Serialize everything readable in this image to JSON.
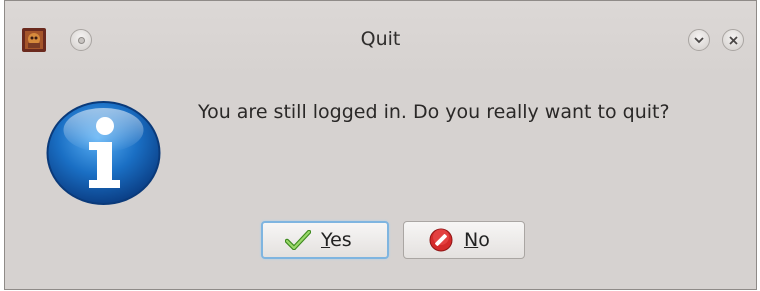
{
  "window": {
    "title": "Quit"
  },
  "titlebar": {
    "app_icon": "app-icon",
    "left_buttons": [
      "pin-icon"
    ],
    "right_buttons": [
      "minimize-icon",
      "close-icon"
    ]
  },
  "dialog": {
    "icon": "information-icon",
    "message": "You are still logged in. Do you really want to quit?"
  },
  "buttons": {
    "yes": {
      "mnemonic": "Y",
      "rest": "es",
      "icon": "checkmark-icon"
    },
    "no": {
      "mnemonic": "N",
      "rest": "o",
      "icon": "no-entry-icon"
    }
  },
  "colors": {
    "window_bg": "#d6d2d0",
    "info_blue": "#1a6fc4",
    "default_button_border": "#7fb5e0",
    "no_red": "#d42a2a",
    "check_green": "#6bbf3b"
  }
}
